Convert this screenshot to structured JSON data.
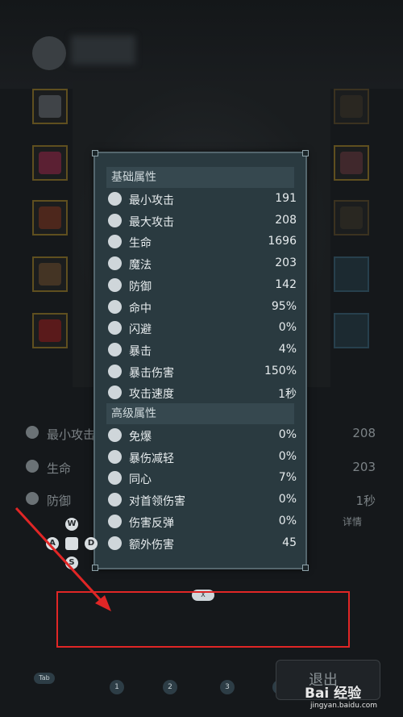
{
  "popup": {
    "basic_title": "基础属性",
    "advanced_title": "高级属性",
    "basic": [
      {
        "icon": "sword-icon",
        "label": "最小攻击",
        "value": "191"
      },
      {
        "icon": "sword-icon",
        "label": "最大攻击",
        "value": "208"
      },
      {
        "icon": "heart-icon",
        "label": "生命",
        "value": "1696"
      },
      {
        "icon": "magic-icon",
        "label": "魔法",
        "value": "203"
      },
      {
        "icon": "shield-icon",
        "label": "防御",
        "value": "142"
      },
      {
        "icon": "target-icon",
        "label": "命中",
        "value": "95%"
      },
      {
        "icon": "dodge-icon",
        "label": "闪避",
        "value": "0%"
      },
      {
        "icon": "crit-icon",
        "label": "暴击",
        "value": "4%"
      },
      {
        "icon": "crit-damage-icon",
        "label": "暴击伤害",
        "value": "150%"
      },
      {
        "icon": "speed-icon",
        "label": "攻击速度",
        "value": "1秒"
      }
    ],
    "advanced": [
      {
        "icon": "immune-icon",
        "label": "免爆",
        "value": "0%"
      },
      {
        "icon": "crit-reduce-icon",
        "label": "暴伤减轻",
        "value": "0%"
      },
      {
        "icon": "concentric-icon",
        "label": "同心",
        "value": "7%"
      },
      {
        "icon": "boss-damage-icon",
        "label": "对首领伤害",
        "value": "0%"
      },
      {
        "icon": "reflect-icon",
        "label": "伤害反弹",
        "value": "0%"
      },
      {
        "icon": "extra-damage-icon",
        "label": "额外伤害",
        "value": "45"
      }
    ]
  },
  "background_stats": {
    "row1": {
      "label": "最小攻击",
      "value": "208"
    },
    "row2": {
      "label": "生命",
      "value": "203"
    },
    "row3": {
      "label": "防御",
      "value": "1秒"
    },
    "detail": "详情"
  },
  "dpad": {
    "up": "W",
    "left": "A",
    "right": "D",
    "down": "S"
  },
  "badge": "X",
  "hotbar": {
    "tab": "Tab",
    "keys": [
      "1",
      "2",
      "3",
      "4"
    ]
  },
  "exit_label": "退出",
  "watermark": {
    "brand": "Bai 经验",
    "url": "jingyan.baidu.com"
  },
  "colors": {
    "highlight": "#e02626",
    "panel": "#2a3a40",
    "slot_border": "#5f4f1f"
  }
}
